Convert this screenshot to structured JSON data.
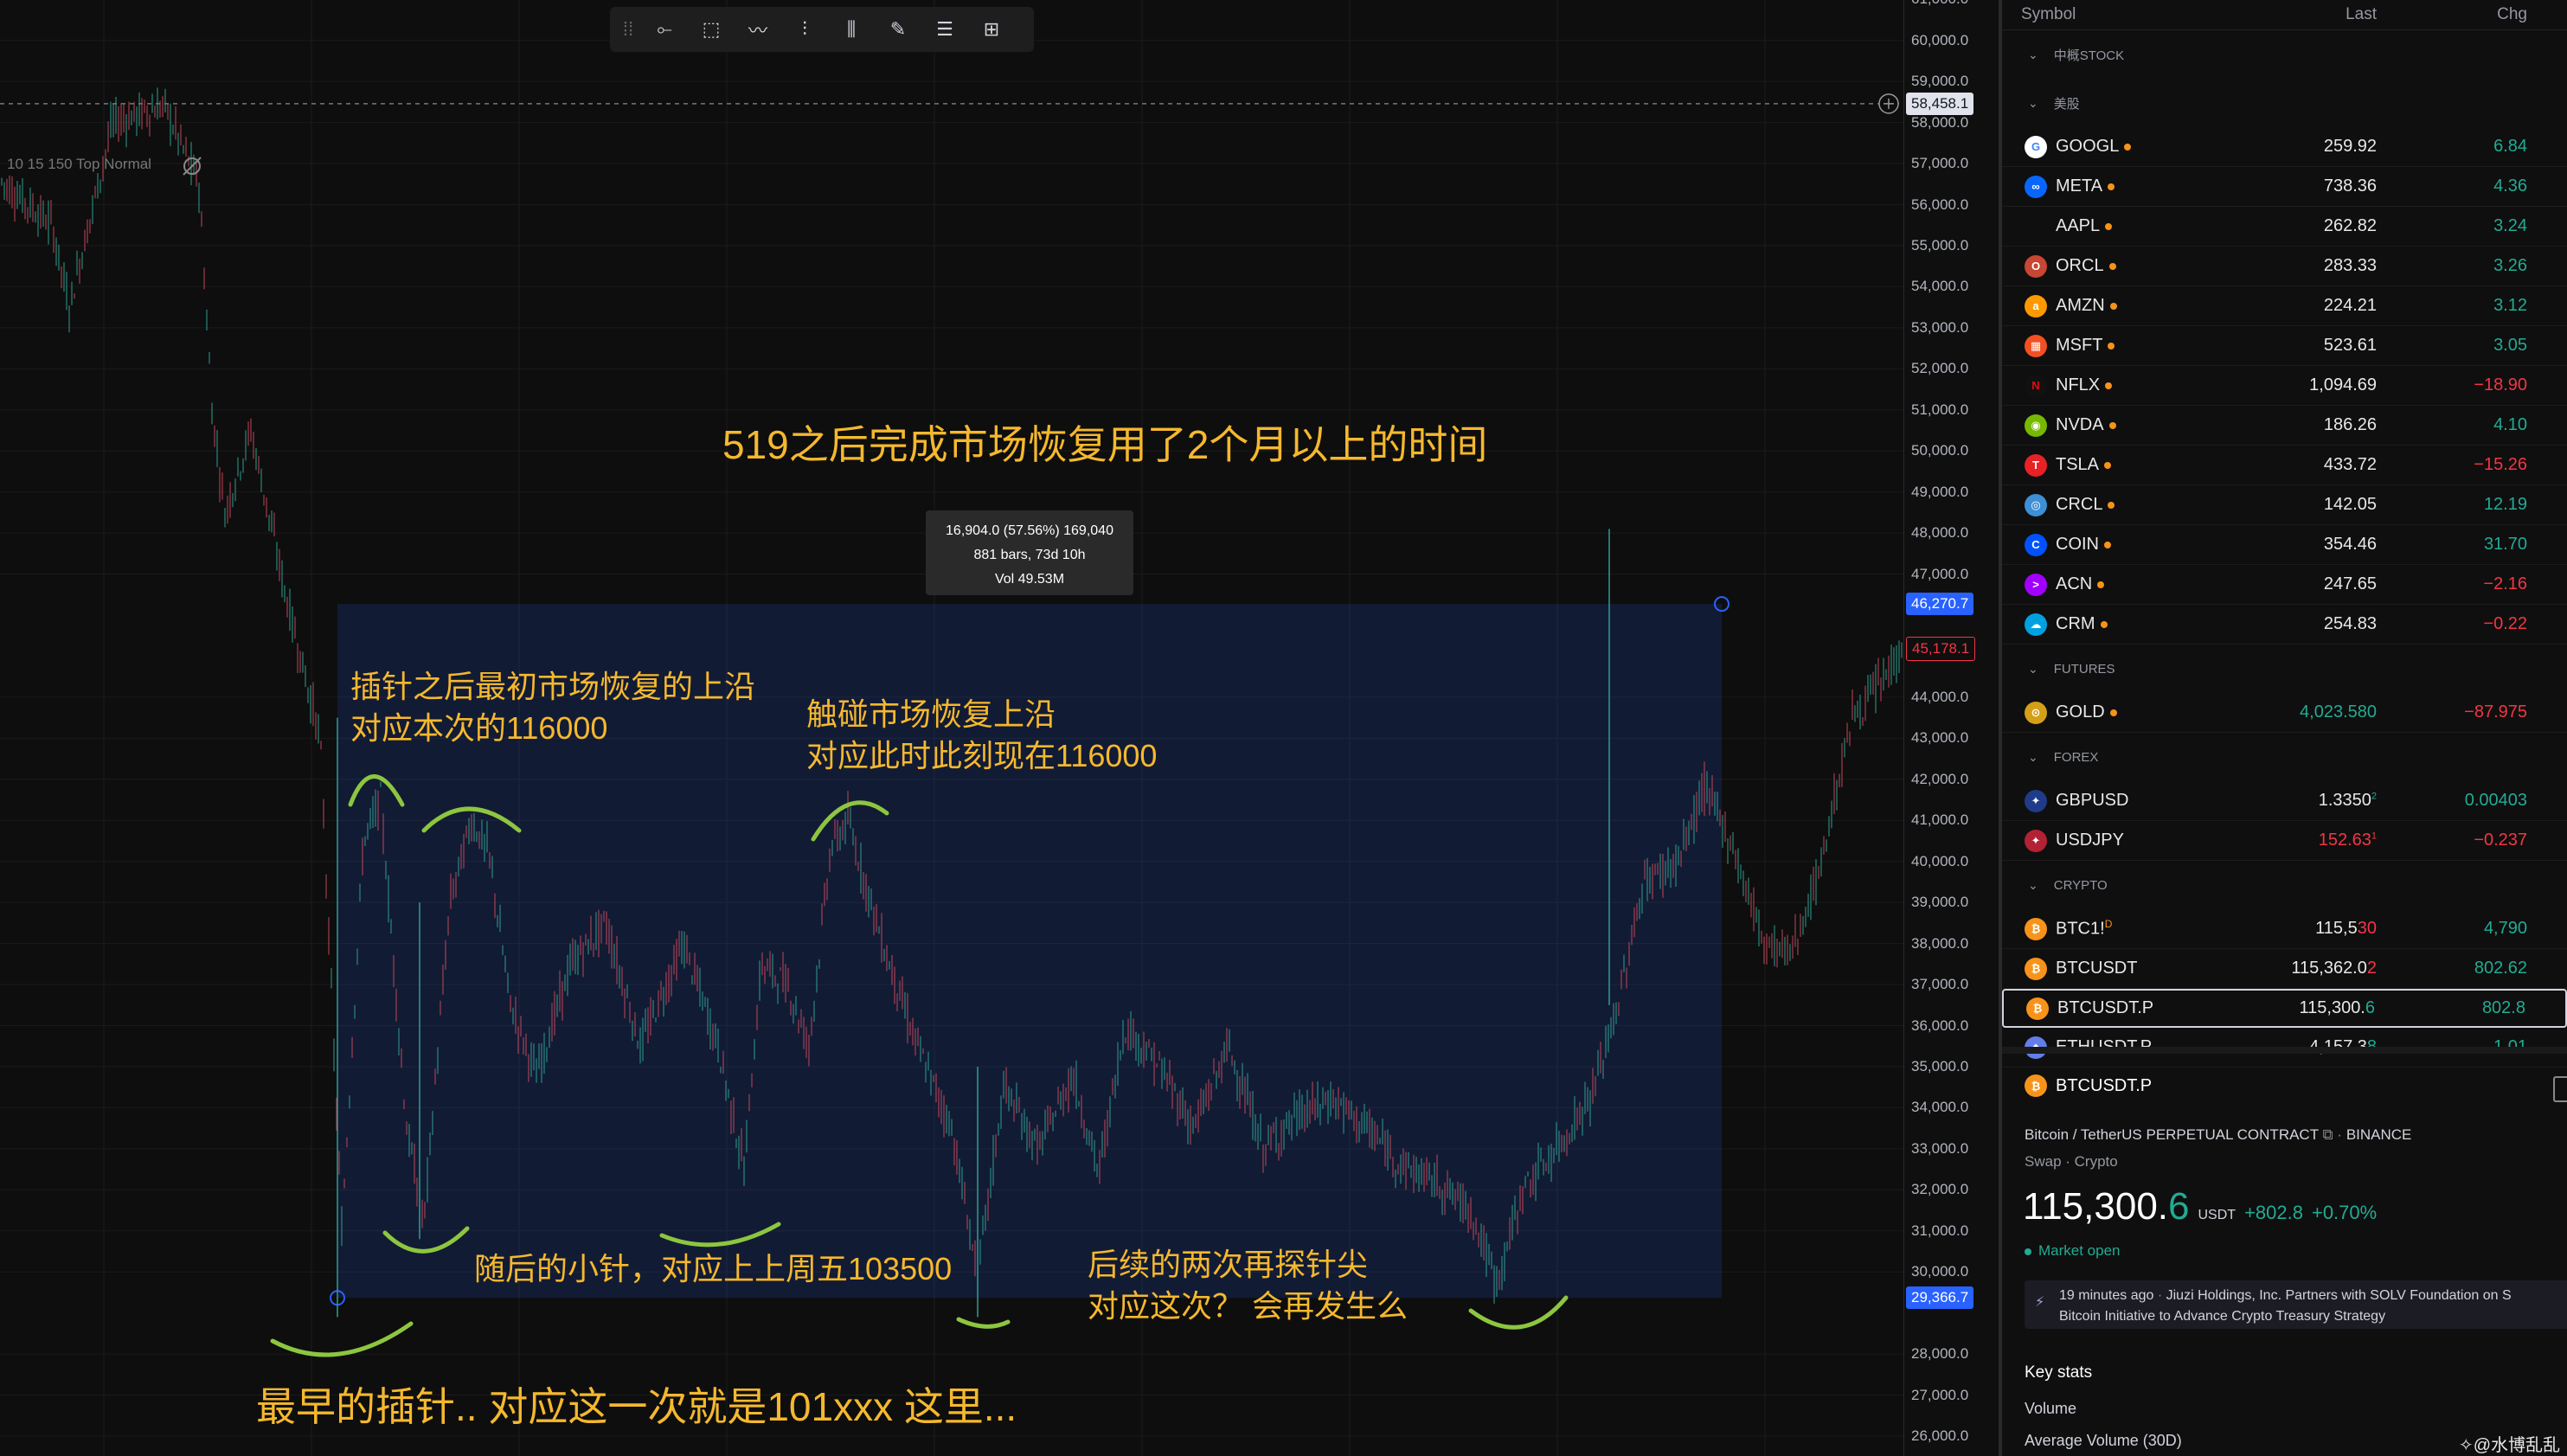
{
  "toolbar": {
    "icons": [
      "drag-grip-icon",
      "horizontal-line-icon",
      "rectangle-icon",
      "path-icon",
      "fib-icon",
      "candles-icon",
      "brush-icon",
      "text-lines-icon",
      "frame-icon"
    ]
  },
  "chart": {
    "indicator_legend": "10 15 150 Top Normal",
    "price_ticks": [
      "61,000.0",
      "60,000.0",
      "59,000.0",
      "58,000.0",
      "57,000.0",
      "56,000.0",
      "55,000.0",
      "54,000.0",
      "53,000.0",
      "52,000.0",
      "51,000.0",
      "50,000.0",
      "49,000.0",
      "48,000.0",
      "47,000.0",
      "44,000.0",
      "43,000.0",
      "42,000.0",
      "41,000.0",
      "40,000.0",
      "39,000.0",
      "38,000.0",
      "37,000.0",
      "36,000.0",
      "35,000.0",
      "34,000.0",
      "33,000.0",
      "32,000.0",
      "31,000.0",
      "30,000.0",
      "28,000.0",
      "27,000.0",
      "26,000.0"
    ],
    "crosshair_price": "58,458.1",
    "range_top_price": "46,270.7",
    "current_price_tag": "45,178.1",
    "range_bottom_price": "29,366.7",
    "measure": {
      "line1": "16,904.0 (57.56%) 169,040",
      "line2": "881 bars, 73d 10h",
      "line3": "Vol 49.53M"
    },
    "annotations": {
      "title": "519之后完成市场恢复用了2个月以上的时间",
      "left_top_1": "插针之后最初市场恢复的上沿",
      "left_top_2": "对应本次的116000",
      "mid_top_1": "触碰市场恢复上沿",
      "mid_top_2": "对应此时此刻现在116000",
      "bottom_mid": "随后的小针，对应上上周五103500",
      "bottom_right_1": "后续的两次再探针尖",
      "bottom_right_2": "对应这次？ 会再发生么",
      "bottom_left": "最早的插针.. 对应这一次就是101xxx 这里..."
    }
  },
  "watchlist": {
    "headers": {
      "symbol": "Symbol",
      "last": "Last",
      "chg": "Chg"
    },
    "groups": [
      {
        "name": "中概STOCK",
        "rows": []
      },
      {
        "name": "美股",
        "rows": [
          {
            "symbol": "GOOGL",
            "last": "259.92",
            "chg": "6.84",
            "dir": "up",
            "logo": "G",
            "color": "#ffffff",
            "logo_text_color": "#4285f4"
          },
          {
            "symbol": "META",
            "last": "738.36",
            "chg": "4.36",
            "dir": "up",
            "logo": "∞",
            "color": "#0866ff"
          },
          {
            "symbol": "AAPL",
            "last": "262.82",
            "chg": "3.24",
            "dir": "up",
            "logo": "",
            "color": "#0f0f0f"
          },
          {
            "symbol": "ORCL",
            "last": "283.33",
            "chg": "3.26",
            "dir": "up",
            "logo": "O",
            "color": "#c74634"
          },
          {
            "symbol": "AMZN",
            "last": "224.21",
            "chg": "3.12",
            "dir": "up",
            "logo": "a",
            "color": "#ff9900"
          },
          {
            "symbol": "MSFT",
            "last": "523.61",
            "chg": "3.05",
            "dir": "up",
            "logo": "▦",
            "color": "#f25022"
          },
          {
            "symbol": "NFLX",
            "last": "1,094.69",
            "chg": "−18.90",
            "dir": "down",
            "logo": "N",
            "color": "#111111",
            "logo_text_color": "#e50914"
          },
          {
            "symbol": "NVDA",
            "last": "186.26",
            "chg": "4.10",
            "dir": "up",
            "logo": "◉",
            "color": "#76b900"
          },
          {
            "symbol": "TSLA",
            "last": "433.72",
            "chg": "−15.26",
            "dir": "down",
            "logo": "T",
            "color": "#e82127"
          },
          {
            "symbol": "CRCL",
            "last": "142.05",
            "chg": "12.19",
            "dir": "up",
            "logo": "◎",
            "color": "#3d8fd6"
          },
          {
            "symbol": "COIN",
            "last": "354.46",
            "chg": "31.70",
            "dir": "up",
            "logo": "C",
            "color": "#0052ff"
          },
          {
            "symbol": "ACN",
            "last": "247.65",
            "chg": "−2.16",
            "dir": "down",
            "logo": ">",
            "color": "#a100ff"
          },
          {
            "symbol": "CRM",
            "last": "254.83",
            "chg": "−0.22",
            "dir": "down",
            "logo": "☁",
            "color": "#00a1e0"
          }
        ]
      },
      {
        "name": "FUTURES",
        "rows": [
          {
            "symbol": "GOLD",
            "last": "4,023.580",
            "chg": "−87.975",
            "dir": "down",
            "last_color": "green",
            "logo": "⊙",
            "color": "#d4a017"
          }
        ]
      },
      {
        "name": "FOREX",
        "rows": [
          {
            "symbol": "GBPUSD",
            "last": "1.3350",
            "last_sup": "2",
            "chg": "0.00403",
            "dir": "up",
            "logo": "✦",
            "color": "#1f3b8a"
          },
          {
            "symbol": "USDJPY",
            "last": "152.63",
            "last_sup": "1",
            "chg": "−0.237",
            "dir": "down",
            "last_color": "red",
            "logo": "✦",
            "color": "#b22234"
          }
        ]
      },
      {
        "name": "CRYPTO",
        "rows": [
          {
            "symbol": "BTC1!",
            "sym_sup": "D",
            "last": "115,5",
            "last_tail": "30",
            "chg": "4,790",
            "dir": "up",
            "logo": "₿",
            "color": "#f7931a"
          },
          {
            "symbol": "BTCUSDT",
            "last": "115,362.0",
            "last_tail": "2",
            "chg": "802.62",
            "dir": "up",
            "logo": "₿",
            "color": "#f7931a"
          },
          {
            "symbol": "BTCUSDT.P",
            "last": "115,300.",
            "last_tail": "6",
            "chg": "802.8",
            "dir": "up",
            "logo": "₿",
            "color": "#f7931a",
            "selected": true
          },
          {
            "symbol": "ETHUSDT.P",
            "last": "4,157.3",
            "last_tail": "8",
            "chg": "1.01",
            "dir": "up",
            "logo": "◆",
            "color": "#627eea"
          }
        ]
      }
    ]
  },
  "details": {
    "symbol": "BTCUSDT.P",
    "description": "Bitcoin / TetherUS PERPETUAL CONTRACT",
    "exchange": "BINANCE",
    "type": "Swap · Crypto",
    "price_main": "115,300.",
    "price_tail": "6",
    "currency": "USDT",
    "change": "+802.8",
    "change_pct": "+0.70%",
    "status": "Market open",
    "news_time": "19 minutes ago",
    "news_line1": "Jiuzi Holdings, Inc. Partners with SOLV Foundation on S",
    "news_line2": "Bitcoin Initiative to Advance Crypto Treasury Strategy",
    "key_stats": "Key stats",
    "volume_label": "Volume",
    "avg_volume_label": "Average Volume (30D)"
  },
  "watermark": "@水博乱乱"
}
